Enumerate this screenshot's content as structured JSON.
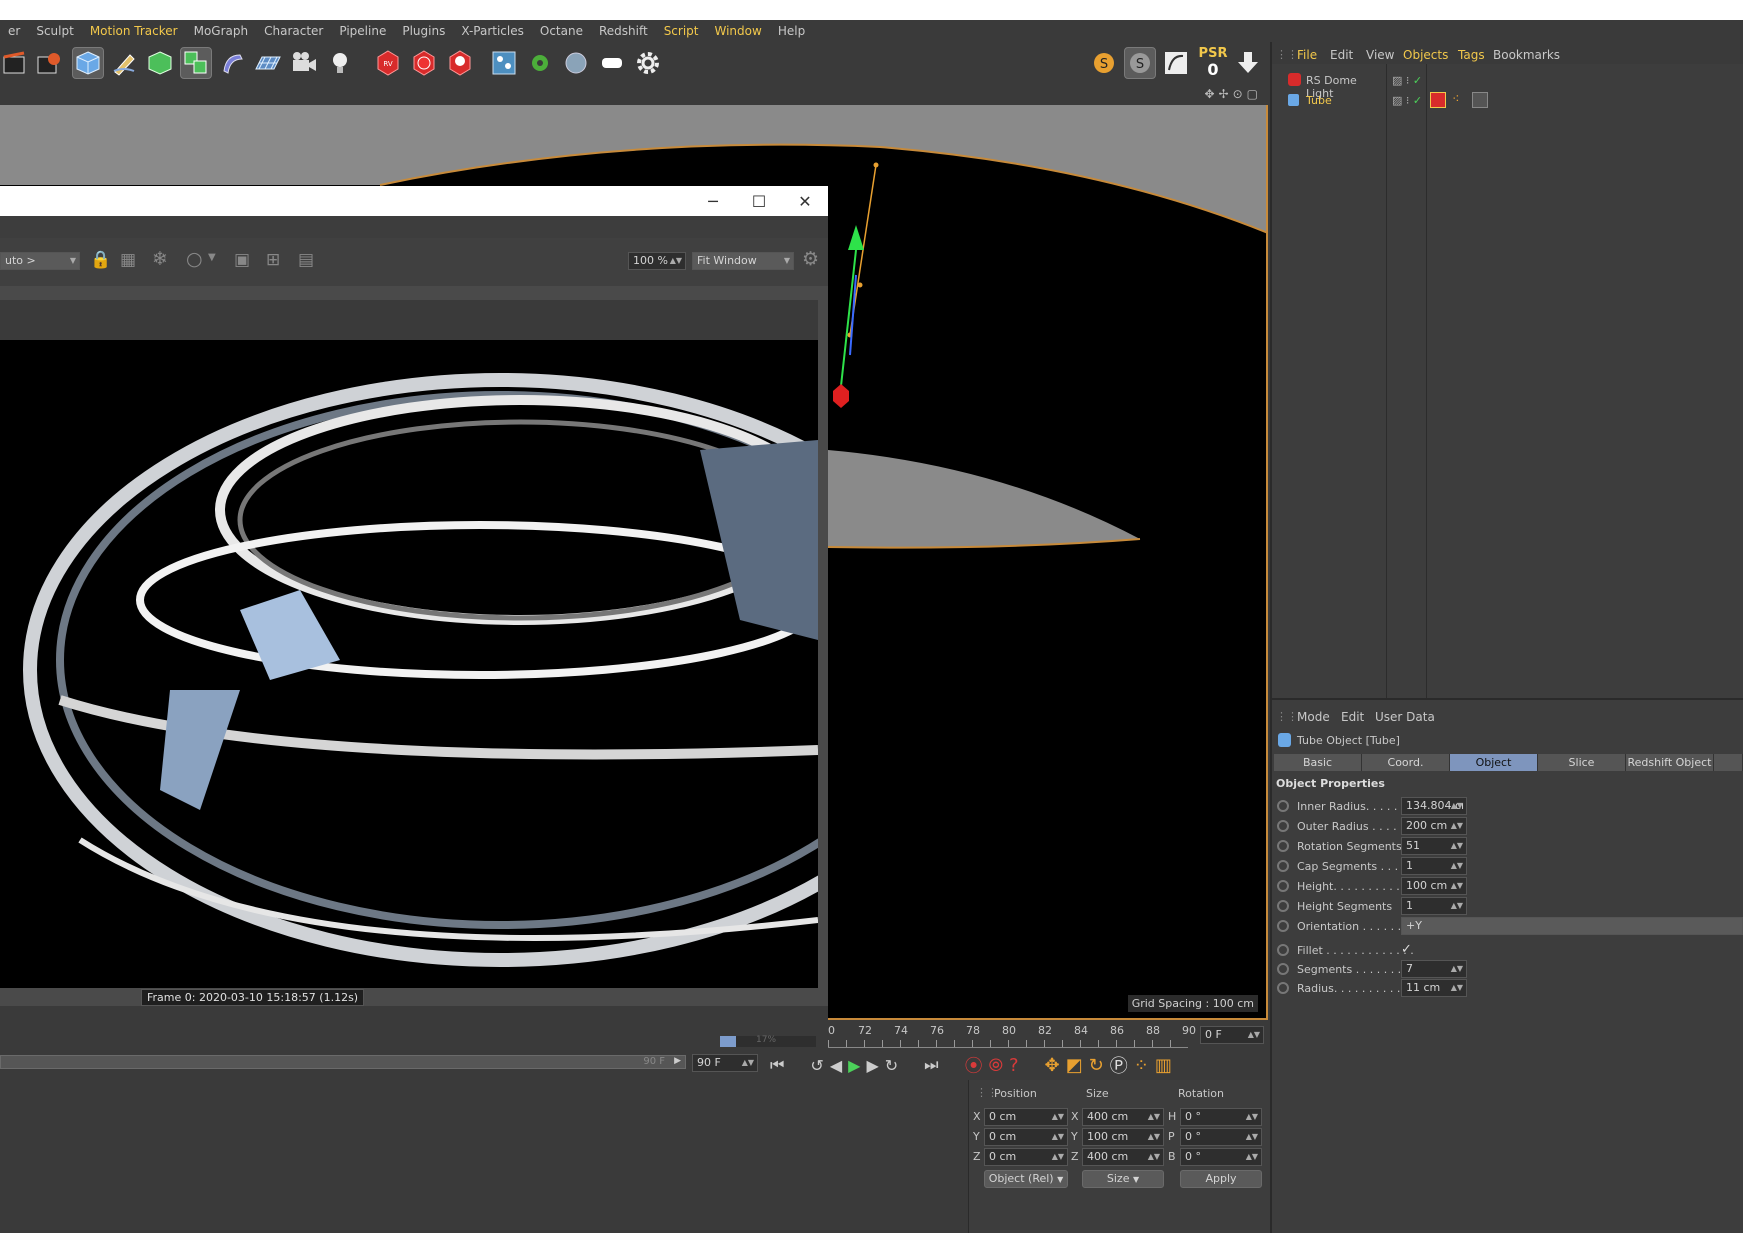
{
  "menubar": {
    "items": [
      {
        "label": "er",
        "hl": false
      },
      {
        "label": "Sculpt",
        "hl": false
      },
      {
        "label": "Motion Tracker",
        "hl": true
      },
      {
        "label": "MoGraph",
        "hl": false
      },
      {
        "label": "Character",
        "hl": false
      },
      {
        "label": "Pipeline",
        "hl": false
      },
      {
        "label": "Plugins",
        "hl": false
      },
      {
        "label": "X-Particles",
        "hl": false
      },
      {
        "label": "Octane",
        "hl": false
      },
      {
        "label": "Redshift",
        "hl": false
      },
      {
        "label": "Script",
        "hl": true
      },
      {
        "label": "Window",
        "hl": true
      },
      {
        "label": "Help",
        "hl": false
      }
    ]
  },
  "toolbar": {
    "psr_label": "PSR",
    "psr_value": "0"
  },
  "viewport": {
    "grid_spacing": "Grid Spacing : 100 cm"
  },
  "picture_viewer": {
    "render_mode": "uto >",
    "zoom": "100 %",
    "fit": "Fit Window",
    "frame_info": "Frame  0:  2020-03-10  15:18:57  (1.12s)",
    "progress": "17%",
    "progress_fraction": 0.17
  },
  "timeline": {
    "ticks": [
      "0",
      "72",
      "74",
      "76",
      "78",
      "80",
      "82",
      "84",
      "86",
      "88",
      "90"
    ],
    "current_frame": "0 F",
    "end_frame_slider": "90 F",
    "end_frame_field": "90 F"
  },
  "object_manager": {
    "menu": [
      {
        "label": "File",
        "hl": true
      },
      {
        "label": "Edit",
        "hl": false
      },
      {
        "label": "View",
        "hl": false
      },
      {
        "label": "Objects",
        "hl": true
      },
      {
        "label": "Tags",
        "hl": true
      },
      {
        "label": "Bookmarks",
        "hl": false
      }
    ],
    "objects": [
      {
        "name": "RS Dome Light",
        "selected": false
      },
      {
        "name": "Tube",
        "selected": true
      }
    ]
  },
  "attribute_manager": {
    "menu": [
      "Mode",
      "Edit",
      "User Data"
    ],
    "title": "Tube Object [Tube]",
    "tabs": [
      {
        "label": "Basic",
        "active": false
      },
      {
        "label": "Coord.",
        "active": false
      },
      {
        "label": "Object",
        "active": true
      },
      {
        "label": "Slice",
        "active": false
      },
      {
        "label": "Redshift Object",
        "active": false
      }
    ],
    "section": "Object Properties",
    "properties": [
      {
        "label": "Inner Radius. . . . . .",
        "value": "134.804 cı"
      },
      {
        "label": "Outer Radius . . . . .",
        "value": "200 cm"
      },
      {
        "label": "Rotation Segments",
        "value": "51"
      },
      {
        "label": "Cap Segments . . . .",
        "value": "1"
      },
      {
        "label": "Height. . . . . . . . . . .",
        "value": "100 cm"
      },
      {
        "label": "Height Segments",
        "value": "1"
      },
      {
        "label": "Orientation . . . . . .",
        "value": "+Y"
      }
    ],
    "fillet_props": [
      {
        "label": "Fillet . . . . . . . . . . . . .",
        "value": "✓"
      },
      {
        "label": "Segments . . . . . . . .",
        "value": "7"
      },
      {
        "label": "Radius. . . . . . . . . . .",
        "value": "11 cm"
      }
    ]
  },
  "coordinates": {
    "headers": [
      "Position",
      "Size",
      "Rotation"
    ],
    "rows": [
      {
        "pos_axis": "X",
        "pos": "0 cm",
        "size_axis": "X",
        "size": "400 cm",
        "rot_axis": "H",
        "rot": "0 °"
      },
      {
        "pos_axis": "Y",
        "pos": "0 cm",
        "size_axis": "Y",
        "size": "100 cm",
        "rot_axis": "P",
        "rot": "0 °"
      },
      {
        "pos_axis": "Z",
        "pos": "0 cm",
        "size_axis": "Z",
        "size": "400 cm",
        "rot_axis": "B",
        "rot": "0 °"
      }
    ],
    "mode": "Object (Rel)",
    "size_mode": "Size",
    "apply": "Apply"
  },
  "colors": {
    "accent": "#f2c84b",
    "active_tab": "#7e95bd",
    "selection_outline": "#c78a3a"
  }
}
